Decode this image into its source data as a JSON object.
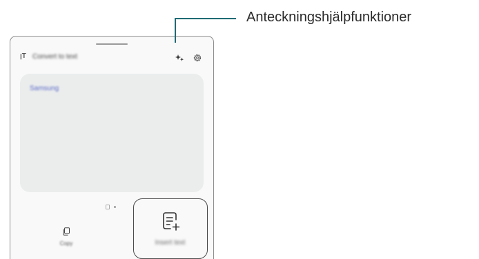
{
  "panel": {
    "toolbar_title": "Convert to text",
    "text_mode_icon": "text-convert-icon",
    "assist_icon": "note-assist-sparkle-icon",
    "settings_icon": "gear-icon"
  },
  "text_area": {
    "content": "Samsung"
  },
  "actions": {
    "copy": {
      "label": "Copy",
      "icon": "copy-icon"
    },
    "insert": {
      "label": "Insert text",
      "icon": "insert-document-icon"
    }
  },
  "callout": {
    "label": "Anteckningshjälpfunktioner",
    "line_color": "#1f6b74"
  }
}
